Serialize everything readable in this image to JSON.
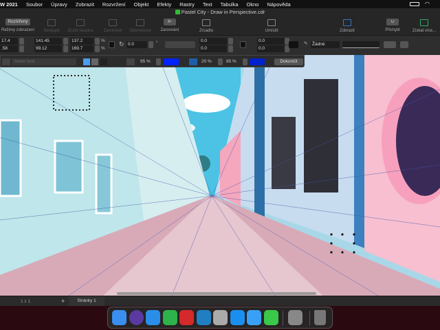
{
  "menubar": {
    "app": "W 2021",
    "items": [
      "Soubor",
      "Úpravy",
      "Zobrazit",
      "Rozvržení",
      "Objekt",
      "Efekty",
      "Rastry",
      "Text",
      "Tabulka",
      "Okno",
      "Nápověda"
    ]
  },
  "title": "Pastel City - Draw in Perspective.cdr",
  "toolbar": {
    "view_mode": "Rozšířený",
    "view_mode_label": "Režimy zobrazení",
    "group": "Seskupit",
    "ungroup": "Zrušit skupinu",
    "lock": "Zamknout",
    "unlock": "Odemknout",
    "align": "Zarovnání",
    "mirror": "Zrcadlo",
    "arrange": "Umístit",
    "display": "Zobrazit",
    "snap": "Přichytit",
    "get_more": "Získat více..."
  },
  "properties": {
    "x": "17.4",
    "y": ".58",
    "w": "141.45",
    "h": "99.12",
    "sx": "137.2",
    "sy": "169.7",
    "pct": "%",
    "rotation": "0.0",
    "deg": "°",
    "pos1": "0.0",
    "pos2": "0.0",
    "pos3": "0.0",
    "pos4": "0.0",
    "outline": "Žádné"
  },
  "perspective_bar": {
    "mode": "Jeden bod",
    "opacity1": "95 %",
    "opacity2": "20 %",
    "opacity3": "85 %",
    "color1": "#0000ff",
    "color2": "#0022cc",
    "done": "Dokončit"
  },
  "pagebar": {
    "page_count": "1 z 1",
    "add": "+",
    "tab": "Stránky 1"
  },
  "dock": [
    "finder",
    "siri",
    "safari",
    "coreldraw",
    "photo-booth",
    "font-manager",
    "launchpad",
    "app-store",
    "mail",
    "messages",
    "system-preferences",
    "trash"
  ]
}
